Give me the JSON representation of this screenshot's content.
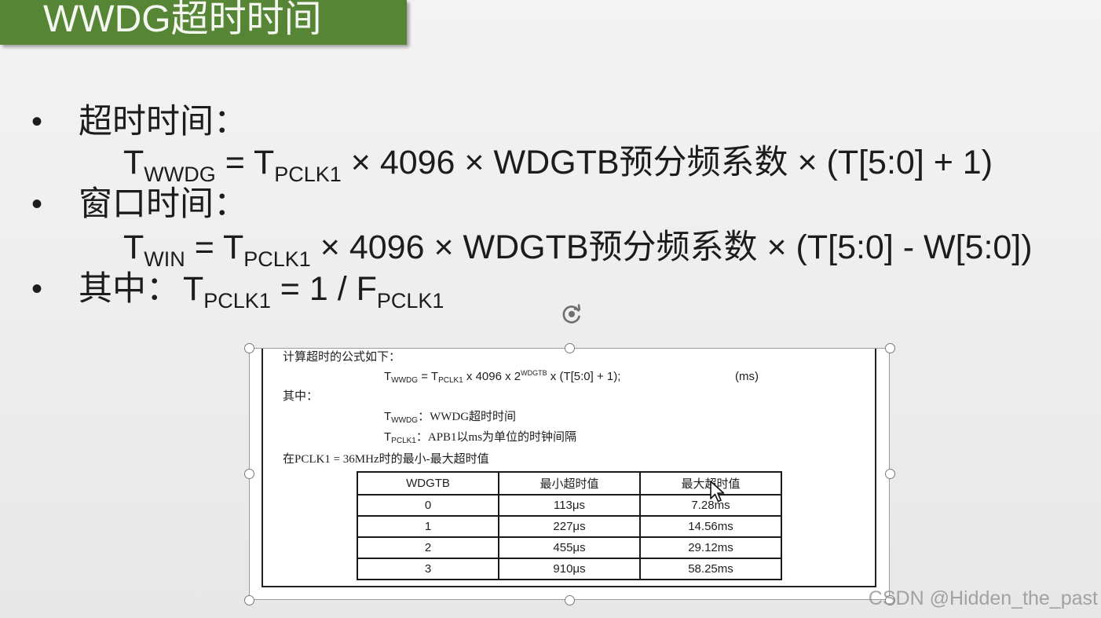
{
  "slide": {
    "title": "WWDG超时时间",
    "bullet": "•",
    "timeout": {
      "label": "超时时间：",
      "formula": {
        "t": "T",
        "sub1": "WWDG",
        "eq": " = T",
        "sub2": "PCLK1",
        "rest": " × 4096 × WDGTB预分频系数 × (T[5:0] + 1)"
      }
    },
    "window": {
      "label": "窗口时间：",
      "formula": {
        "t": "T",
        "sub1": "WIN",
        "eq": " = T",
        "sub2": "PCLK1",
        "rest": " × 4096 × WDGTB预分频系数 × (T[5:0] - W[5:0])"
      }
    },
    "where": {
      "label": "其中：",
      "t": "T",
      "sub1": "PCLK1",
      "mid": " = 1 / F",
      "sub2": "PCLK1"
    }
  },
  "embedded_image": {
    "intro": "计算超时的公式如下：",
    "formula": {
      "t": "T",
      "sub1": "WWDG",
      "eq": " = T",
      "sub2": "PCLK1",
      "mid": " x 4096 x 2",
      "sup": "WDGTB",
      "rest": " x (T[5:0] + 1);"
    },
    "unit": "(ms)",
    "where_label": "其中：",
    "defs": [
      {
        "t": "T",
        "sub": "WWDG",
        "text": "：WWDG超时时间"
      },
      {
        "t": "T",
        "sub": "PCLK1",
        "text": "：APB1以ms为单位的时钟间隔"
      }
    ],
    "table_caption": "在PCLK1 = 36MHz时的最小-最大超时值",
    "table": {
      "headers": [
        "WDGTB",
        "最小超时值",
        "最大超时值"
      ],
      "rows": [
        [
          "0",
          "113μs",
          "7.28ms"
        ],
        [
          "1",
          "227μs",
          "14.56ms"
        ],
        [
          "2",
          "455μs",
          "29.12ms"
        ],
        [
          "3",
          "910μs",
          "58.25ms"
        ]
      ]
    }
  },
  "watermark": "CSDN @Hidden_the_past",
  "icons": {
    "rotate": "rotate-icon",
    "resize_handle": "resize-handle-icon",
    "cursor": "arrow-cursor-icon"
  },
  "colors": {
    "title_bar": "#578536",
    "title_text": "#f4f7f0",
    "background": "#ededed",
    "handle_stroke": "#7a7a7a"
  }
}
